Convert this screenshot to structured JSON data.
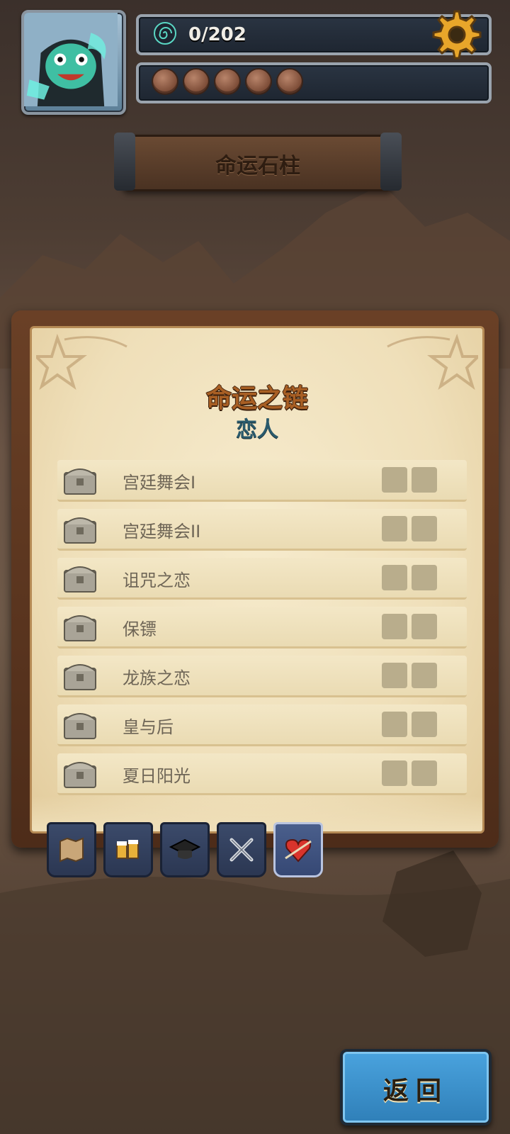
{
  "hud": {
    "progress": "0/202",
    "stone_count": 5
  },
  "title": "命运石柱",
  "panel": {
    "heading": "命运之链",
    "subheading": "恋人",
    "items": [
      {
        "label": "宫廷舞会I"
      },
      {
        "label": "宫廷舞会II"
      },
      {
        "label": "诅咒之恋"
      },
      {
        "label": "保镖"
      },
      {
        "label": "龙族之恋"
      },
      {
        "label": "皇与后"
      },
      {
        "label": "夏日阳光"
      }
    ]
  },
  "tabs": [
    {
      "icon": "map-icon"
    },
    {
      "icon": "beer-mugs-icon"
    },
    {
      "icon": "graduation-cap-icon"
    },
    {
      "icon": "crossed-swords-icon"
    },
    {
      "icon": "heart-arrow-icon",
      "active": true
    }
  ],
  "back_button": "返回",
  "colors": {
    "heading": "#a85f24",
    "subheading": "#2a5a6c",
    "back_button": "#3a92cf"
  }
}
